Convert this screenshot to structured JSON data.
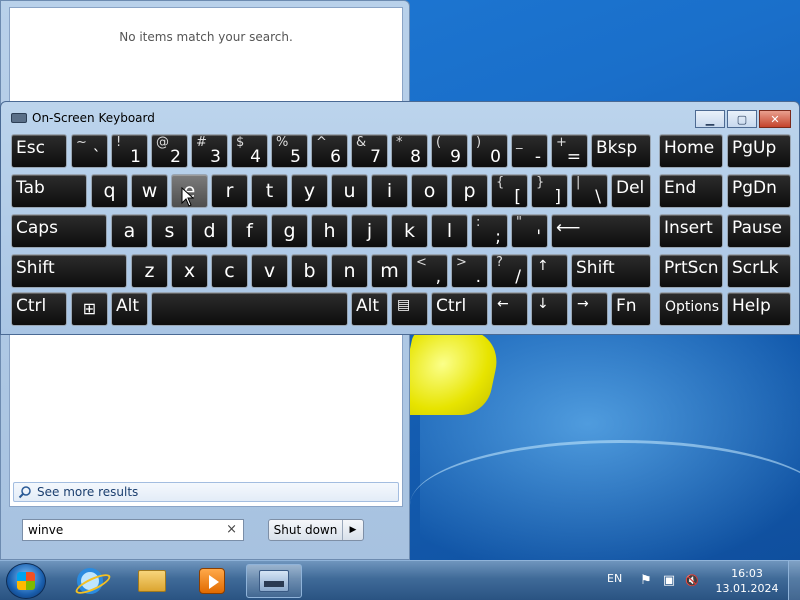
{
  "start_menu": {
    "no_items_text": "No items match your search.",
    "see_more_label": "See more results",
    "search_value": "winve",
    "clear_glyph": "×",
    "shutdown_label": "Shut down",
    "shutdown_arrow": "▶"
  },
  "osk": {
    "title": "On-Screen Keyboard",
    "window_buttons": {
      "minimize": "▁",
      "maximize": "▢",
      "close": "✕"
    },
    "keys": {
      "esc": "Esc",
      "tilde": {
        "top": "~",
        "bot": "`"
      },
      "k1": {
        "top": "!",
        "bot": "1"
      },
      "k2": {
        "top": "@",
        "bot": "2"
      },
      "k3": {
        "top": "#",
        "bot": "3"
      },
      "k4": {
        "top": "$",
        "bot": "4"
      },
      "k5": {
        "top": "%",
        "bot": "5"
      },
      "k6": {
        "top": "^",
        "bot": "6"
      },
      "k7": {
        "top": "&",
        "bot": "7"
      },
      "k8": {
        "top": "*",
        "bot": "8"
      },
      "k9": {
        "top": "(",
        "bot": "9"
      },
      "k0": {
        "top": ")",
        "bot": "0"
      },
      "minus": {
        "top": "_",
        "bot": "-"
      },
      "equals": {
        "top": "+",
        "bot": "="
      },
      "bksp": "Bksp",
      "home": "Home",
      "pgup": "PgUp",
      "tab": "Tab",
      "q": "q",
      "w": "w",
      "e": "e",
      "r": "r",
      "t": "t",
      "y": "y",
      "u": "u",
      "i": "i",
      "o": "o",
      "p": "p",
      "lbracket": {
        "top": "{",
        "bot": "["
      },
      "rbracket": {
        "top": "}",
        "bot": "]"
      },
      "backslash": {
        "top": "|",
        "bot": "\\"
      },
      "del": "Del",
      "end": "End",
      "pgdn": "PgDn",
      "caps": "Caps",
      "a": "a",
      "s": "s",
      "d": "d",
      "f": "f",
      "g": "g",
      "h": "h",
      "j": "j",
      "k": "k",
      "l": "l",
      "semicolon": {
        "top": ":",
        "bot": ";"
      },
      "quote": {
        "top": "\"",
        "bot": "'"
      },
      "enter": "⟵",
      "insert": "Insert",
      "pause": "Pause",
      "shift_l": "Shift",
      "z": "z",
      "x": "x",
      "c": "c",
      "v": "v",
      "b": "b",
      "n": "n",
      "m": "m",
      "comma": {
        "top": "<",
        "bot": ","
      },
      "period": {
        "top": ">",
        "bot": "."
      },
      "slash": {
        "top": "?",
        "bot": "/"
      },
      "up": "↑",
      "shift_r": "Shift",
      "prtscn": "PrtScn",
      "scrlk": "ScrLk",
      "ctrl_l": "Ctrl",
      "win": "⊞",
      "alt_l": "Alt",
      "alt_r": "Alt",
      "menu": "▤",
      "ctrl_r": "Ctrl",
      "left": "←",
      "down": "↓",
      "right": "→",
      "fn": "Fn",
      "options": "Options",
      "help": "Help"
    }
  },
  "taskbar": {
    "language": "EN",
    "time": "16:03",
    "date": "13.01.2024",
    "tray_flag": "⚑",
    "tray_network": "▣",
    "tray_volume": "🔇"
  }
}
